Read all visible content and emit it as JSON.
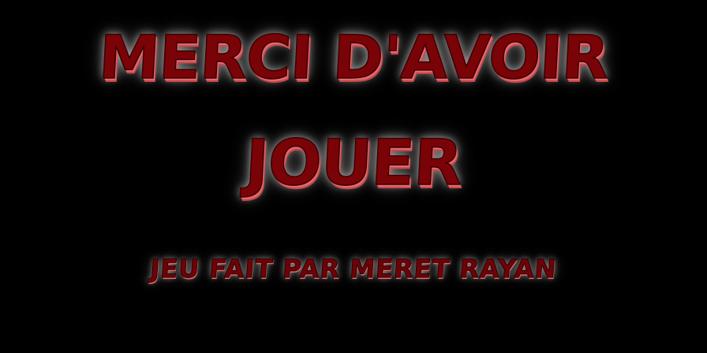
{
  "end_screen": {
    "title_line1": "MERCI D'AVOIR",
    "title_line2": "JOUER",
    "credit": "JEU FAIT PAR MERET RAYAN"
  },
  "colors": {
    "background": "#000000",
    "text_fill": "#7a0308",
    "text_highlight": "#e06a6e",
    "glow": "#ffffff"
  }
}
